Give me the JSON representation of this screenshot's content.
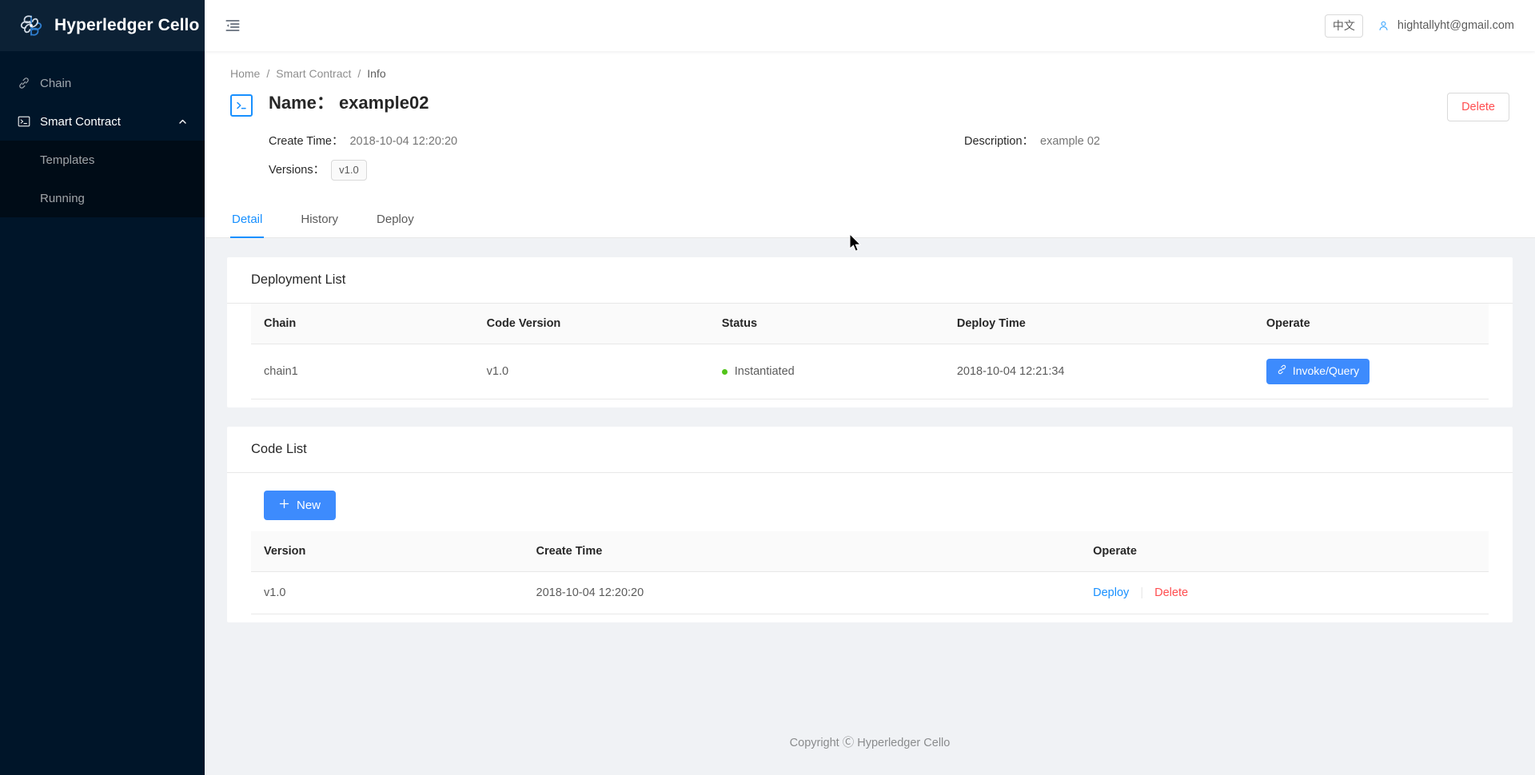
{
  "sidebar": {
    "logo_text": "Hyperledger Cello",
    "logo_icon": "cello-pinwheel-logo",
    "items": [
      {
        "label": "Chain",
        "icon": "chain-link-icon"
      },
      {
        "label": "Smart Contract",
        "icon": "terminal-icon",
        "arrow_icon": "chevron-up-icon"
      }
    ],
    "submenu": [
      {
        "label": "Templates"
      },
      {
        "label": "Running"
      }
    ]
  },
  "topbar": {
    "fold_icon": "menu-fold-icon",
    "language_label": "中文",
    "user_icon": "user-icon",
    "user_name": "hightallyht@gmail.com"
  },
  "page_header": {
    "breadcrumb": [
      "Home",
      "Smart Contract",
      "Info"
    ],
    "breadcrumb_separator": "/",
    "title_icon": "terminal-icon",
    "title_label": "Name",
    "title_colon": "：",
    "title_value": "example02",
    "delete_label": "Delete",
    "fields": [
      {
        "label": "Create Time：",
        "value": "2018-10-04 12:20:20"
      },
      {
        "label": "Versions：",
        "value": "v1.0",
        "is_tag": true
      }
    ],
    "description_label": "Description：",
    "description_value": "example 02",
    "tabs": [
      {
        "label": "Detail",
        "active": true
      },
      {
        "label": "History",
        "active": false
      },
      {
        "label": "Deploy",
        "active": false
      }
    ]
  },
  "deployment_list": {
    "title": "Deployment List",
    "columns": [
      "Chain",
      "Code Version",
      "Status",
      "Deploy Time",
      "Operate"
    ],
    "rows": [
      {
        "chain": "chain1",
        "code_version": "v1.0",
        "status": "Instantiated",
        "status_color": "#52c41a",
        "deploy_time": "2018-10-04 12:21:34",
        "operate_label": "Invoke/Query",
        "operate_icon": "link-icon"
      }
    ]
  },
  "code_list": {
    "title": "Code List",
    "new_button_label": "New",
    "new_button_icon": "plus-icon",
    "columns": [
      "Version",
      "Create Time",
      "Operate"
    ],
    "rows": [
      {
        "version": "v1.0",
        "create_time": "2018-10-04 12:20:20",
        "deploy_label": "Deploy",
        "delete_label": "Delete"
      }
    ]
  },
  "footer": {
    "copyright": "Copyright Ⓒ Hyperledger Cello"
  },
  "theme": {
    "sidebar_bg": "#001529",
    "submenu_bg": "#000c17",
    "primary": "#1890ff",
    "button_blue": "#3d8bfd",
    "danger": "#ff4d4f",
    "success": "#52c41a",
    "page_bg": "#f0f2f5"
  }
}
